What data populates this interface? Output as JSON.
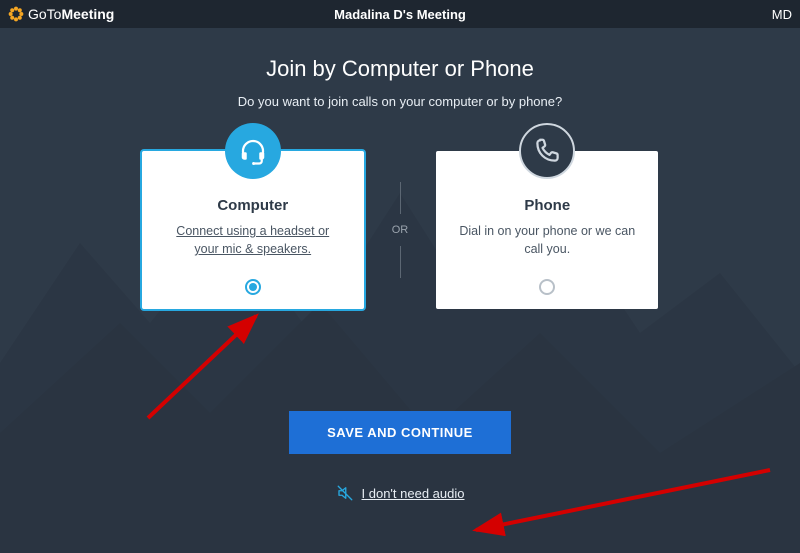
{
  "colors": {
    "accent": "#27a8e0",
    "primary_button": "#1e6fd6",
    "brand_logo": "#f5a623",
    "background": "#2e3a48"
  },
  "header": {
    "brand_prefix": "GoTo",
    "brand_suffix": "Meeting",
    "meeting_title": "Madalina D's Meeting",
    "user_initials": "MD"
  },
  "page": {
    "title": "Join by Computer or Phone",
    "subtitle": "Do you want to join calls on your computer or by phone?"
  },
  "options": {
    "computer": {
      "title": "Computer",
      "description": "Connect using a headset or your mic & speakers.",
      "selected": true
    },
    "or_label": "OR",
    "phone": {
      "title": "Phone",
      "description": "Dial in on your phone or we can call you.",
      "selected": false
    }
  },
  "actions": {
    "save_label": "SAVE AND CONTINUE",
    "no_audio_label": "I don't need audio"
  }
}
